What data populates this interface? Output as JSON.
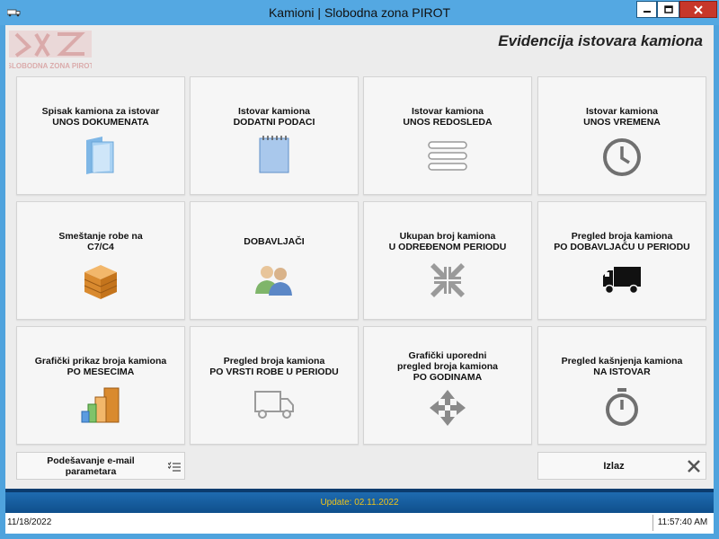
{
  "window": {
    "title": "Kamioni | Slobodna zona PIROT"
  },
  "header": {
    "logo_text": "SLOBODNA ZONA PIROT",
    "title": "Evidencija istovara kamiona"
  },
  "tiles": [
    {
      "line1": "Spisak kamiona za istovar",
      "line2": "UNOS DOKUMENATA",
      "line3": "",
      "icon": "folder-icon"
    },
    {
      "line1": "Istovar kamiona",
      "line2": "DODATNI PODACI",
      "line3": "",
      "icon": "notepad-icon"
    },
    {
      "line1": "Istovar kamiona",
      "line2": "UNOS REDOSLEDA",
      "line3": "",
      "icon": "list-order-icon"
    },
    {
      "line1": "Istovar kamiona",
      "line2": "UNOS VREMENA",
      "line3": "",
      "icon": "clock-icon"
    },
    {
      "line1": "Smeštanje robe na",
      "line2": "C7/C4",
      "line3": "",
      "icon": "crate-icon"
    },
    {
      "line1": "DOBAVLJAČI",
      "line2": "",
      "line3": "",
      "icon": "users-icon"
    },
    {
      "line1": "Ukupan broj kamiona",
      "line2": "U ODREĐENOM PERIODU",
      "line3": "",
      "icon": "collapse-arrows-icon"
    },
    {
      "line1": "Pregled broja kamiona",
      "line2": "PO DOBAVLJAČU U PERIODU",
      "line3": "",
      "icon": "truck-solid-icon"
    },
    {
      "line1": "Grafički prikaz broja kamiona",
      "line2": "PO MESECIMA",
      "line3": "",
      "icon": "stacked-boxes-icon"
    },
    {
      "line1": "Pregled broja kamiona",
      "line2": "PO VRSTI ROBE U PERIODU",
      "line3": "",
      "icon": "truck-outline-icon"
    },
    {
      "line1": "Grafički uporedni",
      "line2": "pregled broja kamiona",
      "line3": "PO GODINAMA",
      "icon": "move-arrows-icon"
    },
    {
      "line1": "Pregled kašnjenja kamiona",
      "line2": "NA ISTOVAR",
      "line3": "",
      "icon": "stopwatch-icon"
    }
  ],
  "buttons": {
    "email_settings_line1": "Podešavanje e-mail",
    "email_settings_line2": "parametara",
    "exit": "Izlaz"
  },
  "status": {
    "update": "Update: 02.11.2022",
    "date": "11/18/2022",
    "time": "11:57:40 AM"
  },
  "colors": {
    "titlebar": "#54a8e2",
    "statusbar": "#1560a3",
    "update_text": "#f0c419",
    "close_button": "#c7372a"
  }
}
